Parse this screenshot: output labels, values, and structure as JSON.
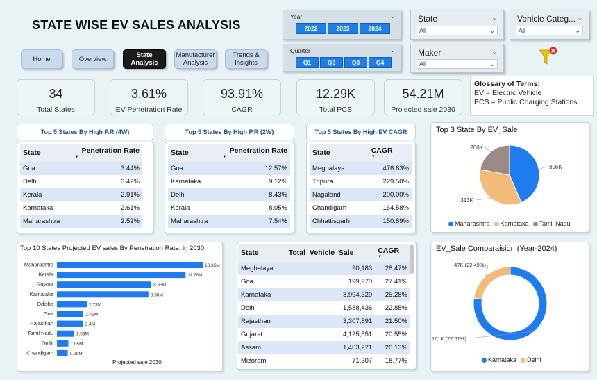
{
  "title": "STATE WISE EV  SALES ANALYSIS",
  "nav": [
    {
      "label": "Home"
    },
    {
      "label": "Overview"
    },
    {
      "label": "State Analysis",
      "active": true
    },
    {
      "label": "Manufacturer Analysis"
    },
    {
      "label": "Trends & Insights"
    }
  ],
  "year_slicer": {
    "label": "Year",
    "options": [
      "2022",
      "2023",
      "2024"
    ],
    "selected": [
      "2022",
      "2023",
      "2024"
    ]
  },
  "quarter_slicer": {
    "label": "Quarter",
    "options": [
      "Q1",
      "Q2",
      "Q3",
      "Q4"
    ],
    "selected": [
      "Q1",
      "Q2",
      "Q3",
      "Q4"
    ]
  },
  "dropdowns": {
    "state": {
      "label": "State",
      "value": "All"
    },
    "vehicle_category": {
      "label": "Vehicle Categ...",
      "value": "All"
    },
    "maker": {
      "label": "Maker",
      "value": "All"
    }
  },
  "kpis": [
    {
      "value": "34",
      "label": "Total States"
    },
    {
      "value": "3.61%",
      "label": "EV Penetration Rate"
    },
    {
      "value": "93.91%",
      "label": "CAGR"
    },
    {
      "value": "12.29K",
      "label": "Total PCS"
    },
    {
      "value": "54.21M",
      "label": "Projected sale 2030"
    }
  ],
  "glossary": {
    "title": "Glossary of Terms:",
    "lines": [
      "EV =  Electric Vehicle",
      "PCS = Public Charging Stations"
    ]
  },
  "table_4w": {
    "title": "Top 5 States By High  P.R (4W)",
    "headers": [
      "State",
      "Penetration Rate"
    ],
    "rows": [
      [
        "Goa",
        "3.44%"
      ],
      [
        "Delhi",
        "3.42%"
      ],
      [
        "Kerala",
        "2.91%"
      ],
      [
        "Karnataka",
        "2.61%"
      ],
      [
        "Maharashtra",
        "2.52%"
      ]
    ]
  },
  "table_2w": {
    "title": "Top 5 States By High  P.R (2W)",
    "headers": [
      "State",
      "Penetration Rate"
    ],
    "rows": [
      [
        "Goa",
        "12.57%"
      ],
      [
        "Karnataka",
        "9.12%"
      ],
      [
        "Delhi",
        "8.43%"
      ],
      [
        "Kerala",
        "8.05%"
      ],
      [
        "Maharashtra",
        "7.54%"
      ]
    ]
  },
  "table_cagr": {
    "title": "Top 5 States By High  EV CAGR",
    "headers": [
      "State",
      "CAGR"
    ],
    "rows": [
      [
        "Meghalaya",
        "476.63%"
      ],
      [
        "Tripura",
        "229.50%"
      ],
      [
        "Nagaland",
        "200.00%"
      ],
      [
        "Chandigarh",
        "164.58%"
      ],
      [
        "Chhattisgarh",
        "150.89%"
      ]
    ]
  },
  "table_sales": {
    "headers": [
      "State",
      "Total_Vehicle_Sale",
      "CAGR"
    ],
    "rows": [
      [
        "Meghalaya",
        "90,183",
        "28.47%"
      ],
      [
        "Goa",
        "199,970",
        "27.41%"
      ],
      [
        "Karnataka",
        "3,994,329",
        "25.28%"
      ],
      [
        "Delhi",
        "1,588,436",
        "22.88%"
      ],
      [
        "Rajasthan",
        "3,307,591",
        "21.50%"
      ],
      [
        "Gujarat",
        "4,125,551",
        "20.55%"
      ],
      [
        "Assam",
        "1,403,271",
        "20.13%"
      ],
      [
        "Mizoram",
        "71,307",
        "18.77%"
      ]
    ]
  },
  "chart_data": [
    {
      "type": "pie",
      "title": "Top 3 State By EV_Sale",
      "categories": [
        "Maharashtra",
        "Karnataka",
        "Tamil Nadu"
      ],
      "values": [
        396,
        313,
        200
      ],
      "labels": [
        "396K",
        "313K",
        "200K"
      ],
      "colors": [
        "#1e7bf0",
        "#f2bb7a",
        "#9b8b87"
      ]
    },
    {
      "type": "bar",
      "orientation": "horizontal",
      "title": "Top 10 States Projected EV sales By Penetration Rate. in 2030",
      "xlabel": "Projected sale 2030",
      "categories": [
        "Maharashtra",
        "Kerala",
        "Gujarat",
        "Karnataka",
        "Odisha",
        "Goa",
        "Rajasthan",
        "Tamil Nadu",
        "Delhi",
        "Chandigarh"
      ],
      "values": [
        13.35,
        11.78,
        8.65,
        8.38,
        2.73,
        2.42,
        2.4,
        1.58,
        1.05,
        0.99
      ],
      "labels": [
        "13.35M",
        "11.78M",
        "8.65M",
        "8.38M",
        "2.73M",
        "2.42M",
        "2.4M",
        "1.58M",
        "1.05M",
        "0.99M"
      ],
      "color": "#1e7bf0"
    },
    {
      "type": "pie",
      "subtype": "donut",
      "title": "EV_Sale Comparaision (Year-2024)",
      "categories": [
        "Karnataka",
        "Delhi"
      ],
      "values": [
        161,
        47
      ],
      "labels": [
        "161K (77.51%)",
        "47K (22.49%)"
      ],
      "colors": [
        "#1e7bf0",
        "#f2bb7a"
      ]
    }
  ]
}
